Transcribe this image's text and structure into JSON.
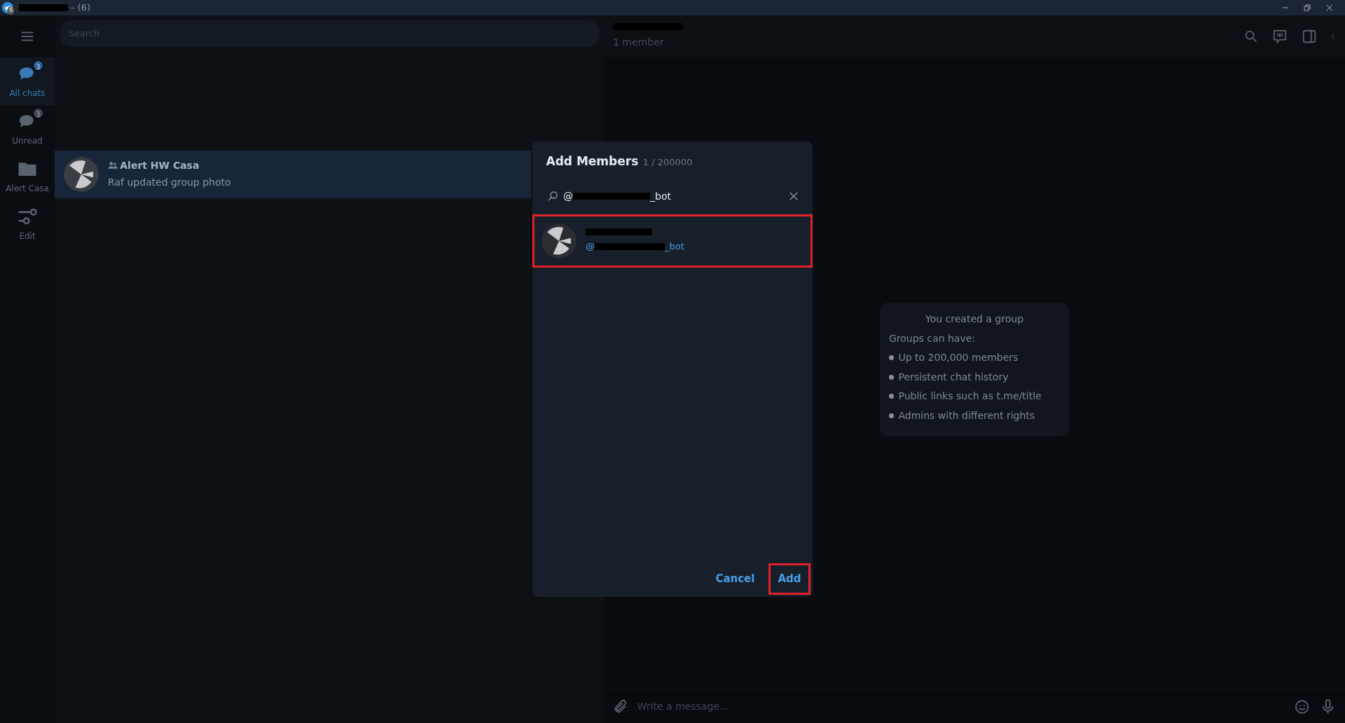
{
  "window": {
    "title": "– (6)",
    "badge": "6"
  },
  "sidebar": {
    "items": [
      {
        "label": "All chats",
        "badge": "3",
        "kind": "chats",
        "selected": true
      },
      {
        "label": "Unread",
        "badge": "3",
        "kind": "chats",
        "selected": false
      },
      {
        "label": "Alert Casa",
        "kind": "folder",
        "selected": false
      },
      {
        "label": "Edit",
        "kind": "sliders",
        "selected": false
      }
    ]
  },
  "search": {
    "placeholder": "Search"
  },
  "chats": [
    {
      "name": "Alert HW Casa",
      "preview": "Raf updated group photo",
      "group": true,
      "selected": true
    }
  ],
  "chat_header": {
    "status": "1 member"
  },
  "service_card": {
    "title": "You created a group",
    "subtitle": "Groups can have:",
    "items": [
      "Up to 200,000 members",
      "Persistent chat history",
      "Public links such as t.me/title",
      "Admins with different rights"
    ]
  },
  "composer": {
    "placeholder": "Write a message..."
  },
  "dialog": {
    "title": "Add Members",
    "count": "1 / 200000",
    "query_start": "@",
    "query_end": "_bot",
    "results": [
      {
        "handle_start": "@",
        "handle_end": "_bot",
        "highlighted": true
      }
    ],
    "buttons": [
      {
        "label": "Cancel",
        "highlighted": false
      },
      {
        "label": "Add",
        "highlighted": true
      }
    ]
  }
}
